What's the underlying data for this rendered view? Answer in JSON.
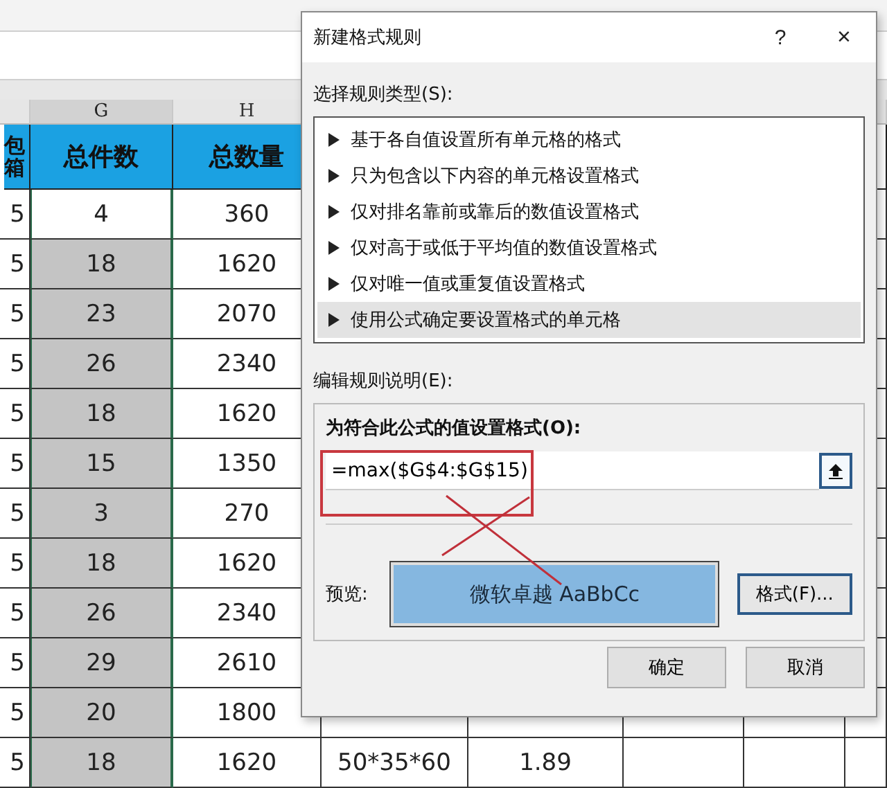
{
  "sheet": {
    "column_letters": [
      {
        "letter": "G",
        "selected": true
      },
      {
        "letter": "H",
        "selected": false
      }
    ],
    "header_row": [
      "包箱",
      "总件数",
      "总数量"
    ],
    "rows": [
      {
        "shaded": false,
        "cells": [
          "5",
          "4",
          "360"
        ]
      },
      {
        "shaded": true,
        "cells": [
          "5",
          "18",
          "1620"
        ]
      },
      {
        "shaded": true,
        "cells": [
          "5",
          "23",
          "2070"
        ]
      },
      {
        "shaded": true,
        "cells": [
          "5",
          "26",
          "2340"
        ]
      },
      {
        "shaded": true,
        "cells": [
          "5",
          "18",
          "1620"
        ]
      },
      {
        "shaded": true,
        "cells": [
          "5",
          "15",
          "1350"
        ]
      },
      {
        "shaded": true,
        "cells": [
          "5",
          "3",
          "270"
        ]
      },
      {
        "shaded": true,
        "cells": [
          "5",
          "18",
          "1620"
        ]
      },
      {
        "shaded": true,
        "cells": [
          "5",
          "26",
          "2340"
        ]
      },
      {
        "shaded": true,
        "cells": [
          "5",
          "29",
          "2610"
        ]
      },
      {
        "shaded": true,
        "cells": [
          "5",
          "20",
          "1800"
        ]
      },
      {
        "shaded": true,
        "cells": [
          "5",
          "18",
          "1620",
          "50*35*60",
          "1.89"
        ]
      }
    ]
  },
  "dialog": {
    "title": "新建格式规则",
    "help": "?",
    "close": "×",
    "rule_type_label": "选择规则类型(S):",
    "rule_types": [
      {
        "label": "基于各自值设置所有单元格的格式",
        "selected": false
      },
      {
        "label": "只为包含以下内容的单元格设置格式",
        "selected": false
      },
      {
        "label": "仅对排名靠前或靠后的数值设置格式",
        "selected": false
      },
      {
        "label": "仅对高于或低于平均值的数值设置格式",
        "selected": false
      },
      {
        "label": "仅对唯一值或重复值设置格式",
        "selected": false
      },
      {
        "label": "使用公式确定要设置格式的单元格",
        "selected": true
      }
    ],
    "edit_label": "编辑规则说明(E):",
    "formula_label": "为符合此公式的值设置格式(O):",
    "formula": "=max($G$4:$G$15)",
    "preview_label": "预览:",
    "preview_text": "微软卓越  AaBbCc",
    "format_button": "格式(F)...",
    "buttons": [
      "确定",
      "取消"
    ]
  }
}
